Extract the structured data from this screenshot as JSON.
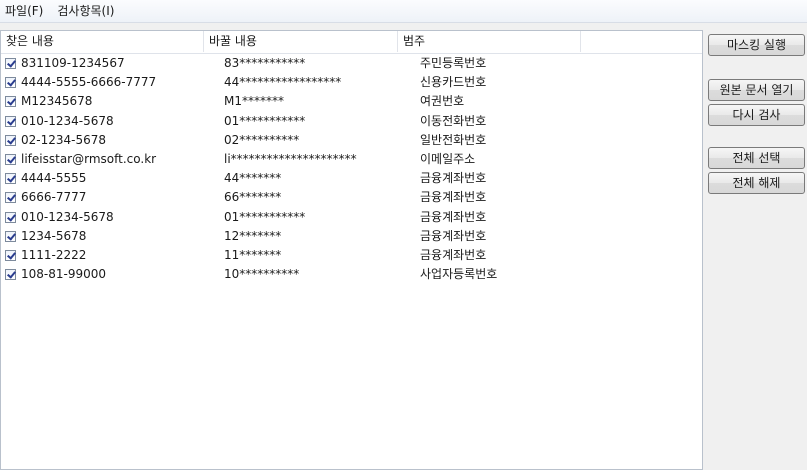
{
  "menu": {
    "file": "파일(F)",
    "inspect": "검사항목(I)"
  },
  "columns": {
    "found": "찾은 내용",
    "replaced": "바꿀 내용",
    "category": "범주",
    "extra": ""
  },
  "rows": [
    {
      "checked": true,
      "found": "831109-1234567",
      "replaced": "83***********",
      "category": "주민등록번호"
    },
    {
      "checked": true,
      "found": "4444-5555-6666-7777",
      "replaced": "44*****************",
      "category": "신용카드번호"
    },
    {
      "checked": true,
      "found": "M12345678",
      "replaced": "M1*******",
      "category": "여권번호"
    },
    {
      "checked": true,
      "found": "010-1234-5678",
      "replaced": "01***********",
      "category": "이동전화번호"
    },
    {
      "checked": true,
      "found": "02-1234-5678",
      "replaced": "02**********",
      "category": "일반전화번호"
    },
    {
      "checked": true,
      "found": "lifeisstar@rmsoft.co.kr",
      "replaced": "li*********************",
      "category": "이메일주소"
    },
    {
      "checked": true,
      "found": "4444-5555",
      "replaced": "44*******",
      "category": "금융계좌번호"
    },
    {
      "checked": true,
      "found": "6666-7777",
      "replaced": "66*******",
      "category": "금융계좌번호"
    },
    {
      "checked": true,
      "found": "010-1234-5678",
      "replaced": "01***********",
      "category": "금융계좌번호"
    },
    {
      "checked": true,
      "found": "1234-5678",
      "replaced": "12*******",
      "category": "금융계좌번호"
    },
    {
      "checked": true,
      "found": "1111-2222",
      "replaced": "11*******",
      "category": "금융계좌번호"
    },
    {
      "checked": true,
      "found": "108-81-99000",
      "replaced": "10**********",
      "category": "사업자등록번호"
    }
  ],
  "buttons": {
    "mask": "마스킹 실행",
    "open_original": "원본 문서 열기",
    "rescan": "다시 검사",
    "select_all": "전체 선택",
    "deselect_all": "전체 해제"
  }
}
